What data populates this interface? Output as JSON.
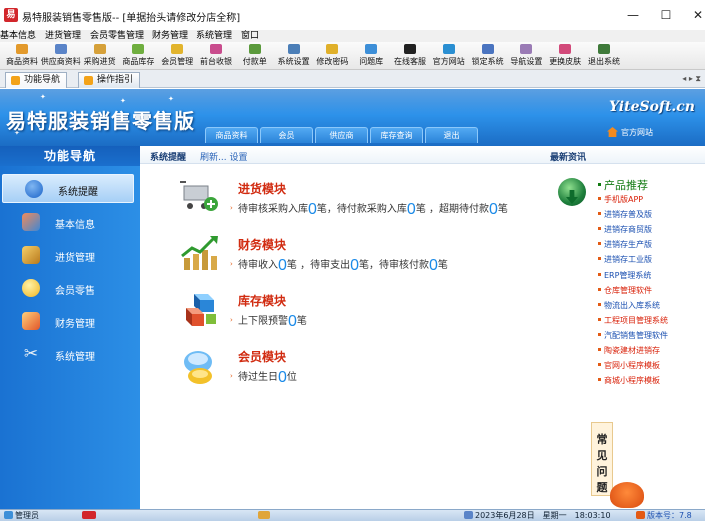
{
  "window": {
    "title": "易特服装销售零售版-- [单据抬头请修改分店全称]",
    "minimize": "—",
    "maximize": "☐",
    "close": "✕"
  },
  "menu": [
    "基本信息",
    "进货管理",
    "会员零售管理",
    "财务管理",
    "系统管理",
    "窗口"
  ],
  "toolbar": [
    {
      "label": "商品资料",
      "icon": "goods-icon",
      "color": "#e39a2c"
    },
    {
      "label": "供应商资料",
      "icon": "supplier-icon",
      "color": "#5a84c8"
    },
    {
      "label": "采购进货",
      "icon": "purchase-icon",
      "color": "#d6a13a"
    },
    {
      "label": "商品库存",
      "icon": "stock-icon",
      "color": "#6fae3f"
    },
    {
      "label": "会员管理",
      "icon": "member-icon",
      "color": "#e2b42d"
    },
    {
      "label": "前台收银",
      "icon": "cashier-icon",
      "color": "#c94c8d"
    },
    {
      "label": "付款单",
      "icon": "payment-icon",
      "color": "#5b9a3c"
    },
    {
      "label": "系统设置",
      "icon": "settings-icon",
      "color": "#4c7fb8"
    },
    {
      "label": "修改密码",
      "icon": "password-icon",
      "color": "#e0b02a"
    },
    {
      "label": "问题库",
      "icon": "faq-icon",
      "color": "#3d8fd8"
    },
    {
      "label": "在线客服",
      "icon": "support-icon",
      "color": "#222222"
    },
    {
      "label": "官方网站",
      "icon": "website-icon",
      "color": "#2a8fd2"
    },
    {
      "label": "锁定系统",
      "icon": "lock-icon",
      "color": "#4a74c0"
    },
    {
      "label": "导航设置",
      "icon": "navigation-icon",
      "color": "#9a7bb5"
    },
    {
      "label": "更换皮肤",
      "icon": "skin-icon",
      "color": "#d24a7a"
    },
    {
      "label": "退出系统",
      "icon": "exit-icon",
      "color": "#3f7a3a"
    }
  ],
  "tabs": [
    {
      "label": "功能导航",
      "active": true
    },
    {
      "label": "操作指引",
      "active": false
    }
  ],
  "tab_nav": "◂ ▸ ⧗",
  "banner": {
    "title": "易特服装销售零售版",
    "url": "YiteSoft.cn",
    "official_site": "官方网站",
    "tabs": [
      "商品资料",
      "会员",
      "供应商",
      "库存查询",
      "退出"
    ]
  },
  "sidebar": {
    "heading": "功能导航",
    "items": [
      {
        "label": "系统提醒",
        "icon": "info-icon",
        "color": "#1a63c8",
        "active": true
      },
      {
        "label": "基本信息",
        "icon": "box-icon",
        "color": "#d9553a",
        "active": false
      },
      {
        "label": "进货管理",
        "icon": "package-icon",
        "color": "#e4a72d",
        "active": false
      },
      {
        "label": "会员零售",
        "icon": "member-icon",
        "color": "#f2c12e",
        "active": false
      },
      {
        "label": "财务管理",
        "icon": "finance-icon",
        "color": "#e86f2a",
        "active": false
      },
      {
        "label": "系统管理",
        "icon": "tools-icon",
        "color": "#c9d4de",
        "active": false
      }
    ]
  },
  "content_head": {
    "system_tip": "系统提醒",
    "refresh": "刷新... 设置",
    "news": "最新资讯"
  },
  "modules": [
    {
      "title": "进货模块",
      "icon": "cart-icon",
      "parts": [
        "待审核采购入库",
        "0",
        "笔，待付款采购入库",
        "0",
        "笔 ，超期待付款",
        "0",
        "笔"
      ]
    },
    {
      "title": "财务模块",
      "icon": "finance-chart-icon",
      "parts": [
        "待审收入",
        "0",
        "笔 ，待审支出",
        "0",
        "笔，待审核付款",
        "0",
        "笔"
      ]
    },
    {
      "title": "库存模块",
      "icon": "cubes-icon",
      "parts": [
        "上下限预警",
        "0",
        "笔"
      ]
    },
    {
      "title": "会员模块",
      "icon": "members-icon",
      "parts": [
        "待过生日",
        "0",
        "位"
      ]
    }
  ],
  "products": {
    "heading": "产品推荐",
    "items": [
      {
        "label": "手机版APP",
        "color": "#d81e06"
      },
      {
        "label": "进销存普及版",
        "color": "#1a4fb0"
      },
      {
        "label": "进销存商贸版",
        "color": "#1a4fb0"
      },
      {
        "label": "进销存生产版",
        "color": "#1a4fb0"
      },
      {
        "label": "进销存工业版",
        "color": "#1a4fb0"
      },
      {
        "label": "ERP管理系统",
        "color": "#1a4fb0"
      },
      {
        "label": "仓库管理软件",
        "color": "#d81e06"
      },
      {
        "label": "物流出入库系统",
        "color": "#1a4fb0"
      },
      {
        "label": "工程项目管理系统",
        "color": "#d81e06"
      },
      {
        "label": "汽配销售管理软件",
        "color": "#1a4fb0"
      },
      {
        "label": "陶瓷建材进销存",
        "color": "#d81e06"
      },
      {
        "label": "官网小程序模板",
        "color": "#d81e06"
      },
      {
        "label": "商城小程序模板",
        "color": "#d81e06"
      }
    ]
  },
  "faq": [
    "常",
    "见",
    "问",
    "题"
  ],
  "statusbar": {
    "user": "管理员",
    "datetime": "2023年6月28日　星期一　18:03:10",
    "version": "版本号：7.8"
  }
}
